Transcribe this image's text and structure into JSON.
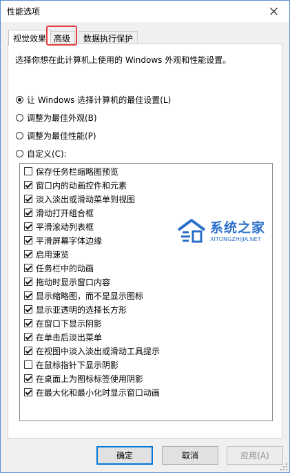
{
  "window": {
    "title": "性能选项"
  },
  "tabs": [
    "视觉效果",
    "高级",
    "数据执行保护"
  ],
  "description": "选择你想在此计算机上使用的 Windows 外观和性能设置。",
  "radios": [
    {
      "label": "让 Windows 选择计算机的最佳设置(L)",
      "selected": true
    },
    {
      "label": "调整为最佳外观(B)",
      "selected": false
    },
    {
      "label": "调整为最佳性能(P)",
      "selected": false
    },
    {
      "label": "自定义(C):",
      "selected": false
    }
  ],
  "effects": [
    {
      "label": "保存任务栏缩略图预览",
      "checked": false
    },
    {
      "label": "窗口内的动画控件和元素",
      "checked": true
    },
    {
      "label": "淡入淡出或滑动菜单到视图",
      "checked": true
    },
    {
      "label": "滑动打开组合框",
      "checked": true
    },
    {
      "label": "平滑滚动列表框",
      "checked": true
    },
    {
      "label": "平滑屏幕字体边缘",
      "checked": true
    },
    {
      "label": "启用速览",
      "checked": true
    },
    {
      "label": "任务栏中的动画",
      "checked": true
    },
    {
      "label": "拖动时显示窗口内容",
      "checked": true
    },
    {
      "label": "显示缩略图，而不是显示图标",
      "checked": true
    },
    {
      "label": "显示亚透明的选择长方形",
      "checked": true
    },
    {
      "label": "在窗口下显示阴影",
      "checked": true
    },
    {
      "label": "在单击后淡出菜单",
      "checked": true
    },
    {
      "label": "在视图中淡入淡出或滑动工具提示",
      "checked": true
    },
    {
      "label": "在鼠标指针下显示阴影",
      "checked": false
    },
    {
      "label": "在桌面上为图标标签使用阴影",
      "checked": true
    },
    {
      "label": "在最大化和最小化时显示窗口动画",
      "checked": true
    }
  ],
  "buttons": {
    "ok": "确定",
    "cancel": "取消",
    "apply": "应用(A)"
  },
  "watermark": {
    "name": "系统之家",
    "site": "XITONGZHIJIA.NET"
  },
  "colors": {
    "accent": "#0078d7",
    "highlight": "#e53e3e",
    "watermark": "#2a6fc9"
  },
  "icons": [
    "close-icon",
    "system-home-logo-icon"
  ]
}
